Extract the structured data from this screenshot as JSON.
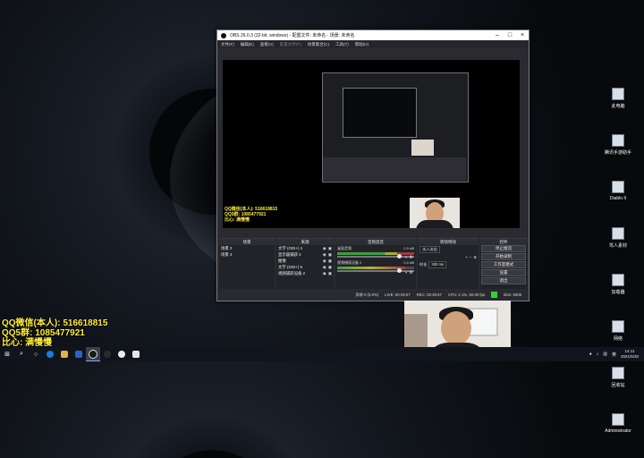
{
  "window": {
    "title": "OBS 26.0.3 (32-bit, windows) - 配置文件: 未命名 - 场景: 未命名"
  },
  "menu": {
    "items": [
      "文件(F)",
      "编辑(E)",
      "查看(V)",
      "配置文件(P)",
      "场景集合(C)",
      "工具(T)",
      "帮助(H)"
    ]
  },
  "overlay": {
    "line1": "QQ微信(本人): 516618815",
    "line2": "QQ5群: 1085477921",
    "line3": "比心: 满慢慢"
  },
  "docks": {
    "scenes": {
      "title": "场景",
      "items": [
        "场景 2",
        "场景 3"
      ]
    },
    "sources": {
      "title": "来源",
      "items": [
        "文字 (GDI+) 4",
        "显示器捕获 2",
        "图像",
        "文字 (GDI+) 5",
        "视频捕获设备 2"
      ]
    },
    "mixer": {
      "title": "音频混音",
      "tracks": [
        {
          "name": "桌面音频",
          "db": "0.0 dB"
        },
        {
          "name": "视频捕获设备 2",
          "db": "0.0 dB"
        }
      ]
    },
    "transitions": {
      "title": "转场特效",
      "type": "淡入淡出",
      "duration_label": "时长",
      "duration": "300 ms"
    },
    "controls": {
      "title": "控件",
      "buttons": [
        "停止推流",
        "开始录制",
        "工作室模式",
        "设置",
        "退出"
      ]
    }
  },
  "status": {
    "drop": "丢帧 0 (0.0%)",
    "live": "LIVE: 00:29:57",
    "rec": "REC: 00:29:57",
    "cpu": "CPU: 2.1%, 60.00 fps",
    "bitrate": "kb/s: 5005"
  },
  "desktop": {
    "icons": [
      "此电脑",
      "腾讯手游助手",
      "Diablo II",
      "驾人素材",
      "加载器",
      "网络",
      "回收站",
      "Administrator",
      "娱乐"
    ]
  },
  "taskbar": {
    "clock_time": "14:11",
    "clock_date": "2021/5/30",
    "tray_lang": "英"
  },
  "colors": {
    "overlay_text": "#ffef3a",
    "obs_background": "#2a2b31",
    "status_ok": "#35d235"
  }
}
